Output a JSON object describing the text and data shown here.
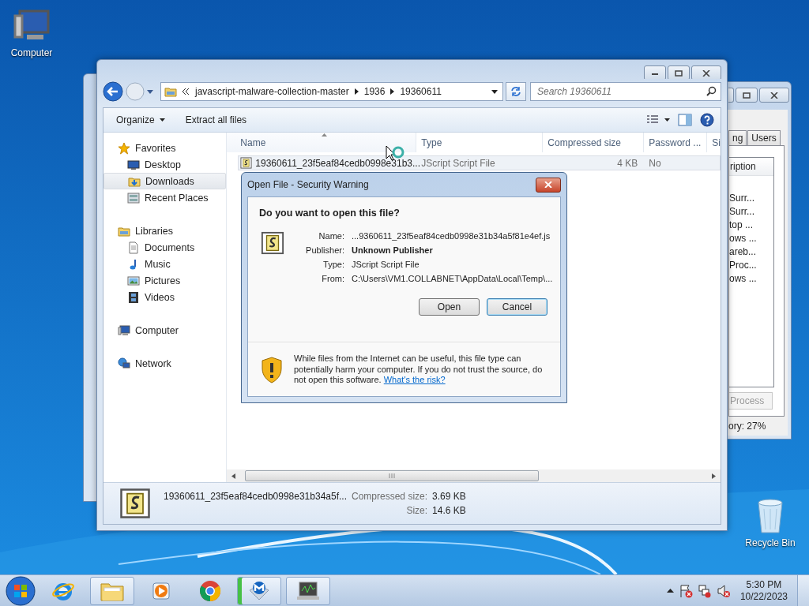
{
  "desktop": {
    "icons": [
      {
        "label": "Computer"
      },
      {
        "label": "Recycle Bin"
      }
    ]
  },
  "task_manager": {
    "tabs": [
      {
        "label": "ng",
        "selected": false
      },
      {
        "label": "Users",
        "selected": false
      }
    ],
    "column": "ription",
    "rows": [
      "Surr...",
      "Surr...",
      "top ...",
      "ows ...",
      "areb...",
      "Proc...",
      "ows ..."
    ],
    "end_button": {
      "label": "Process",
      "disabled": true
    },
    "status": "ory: 27%"
  },
  "explorer": {
    "breadcrumbs": [
      "javascript-malware-collection-master",
      "1936",
      "19360611"
    ],
    "search": {
      "placeholder": "Search 19360611"
    },
    "toolbar": [
      {
        "label": "Organize",
        "kind": "menu"
      },
      {
        "label": "Extract all files",
        "kind": "command"
      }
    ],
    "nav": [
      {
        "label": "Favorites",
        "selected": false,
        "children": [
          {
            "label": "Desktop",
            "selected": false
          },
          {
            "label": "Downloads",
            "selected": true
          },
          {
            "label": "Recent Places",
            "selected": false
          }
        ]
      },
      {
        "label": "Libraries",
        "selected": false,
        "children": [
          {
            "label": "Documents",
            "selected": false
          },
          {
            "label": "Music",
            "selected": false
          },
          {
            "label": "Pictures",
            "selected": false
          },
          {
            "label": "Videos",
            "selected": false
          }
        ]
      },
      {
        "label": "Computer",
        "selected": false
      },
      {
        "label": "Network",
        "selected": false
      }
    ],
    "columns": [
      {
        "label": "Name",
        "sorted": true
      },
      {
        "label": "Type",
        "sorted": false
      },
      {
        "label": "Compressed size",
        "sorted": false
      },
      {
        "label": "Password ...",
        "sorted": false
      },
      {
        "label": "Si",
        "sorted": false
      }
    ],
    "rows": [
      {
        "name": "19360611_23f5eaf84cedb0998e31b3...",
        "type": "JScript Script File",
        "compressed_size": "4 KB",
        "password": "No",
        "selected": true
      }
    ],
    "details": {
      "name": "19360611_23f5eaf84cedb0998e31b34a5f...",
      "fields": [
        {
          "label": "Compressed size:",
          "value": "3.69 KB"
        },
        {
          "label": "Size:",
          "value": "14.6 KB"
        }
      ]
    }
  },
  "dialog": {
    "title": "Open File - Security Warning",
    "question": "Do you want to open this file?",
    "fields": [
      {
        "label": "Name:",
        "value": "...9360611_23f5eaf84cedb0998e31b34a5f81e4ef.js",
        "kind": "plain"
      },
      {
        "label": "Publisher:",
        "value": "Unknown Publisher",
        "kind": "strong"
      },
      {
        "label": "Type:",
        "value": "JScript Script File",
        "kind": "plain"
      },
      {
        "label": "From:",
        "value": "C:\\Users\\VM1.COLLABNET\\AppData\\Local\\Temp\\...",
        "kind": "plain"
      }
    ],
    "buttons": [
      {
        "label": "Open",
        "default": false
      },
      {
        "label": "Cancel",
        "default": true
      }
    ],
    "warning": "While files from the Internet can be useful, this file type can potentially harm your computer. If you do not trust the source, do not open this software.",
    "risk_link": "What's the risk?"
  },
  "taskbar": {
    "items": [
      {
        "kind": "browser-e",
        "running": false
      },
      {
        "kind": "folders",
        "running": true
      },
      {
        "kind": "media",
        "running": false
      },
      {
        "kind": "chrome",
        "running": false
      },
      {
        "kind": "shield-m",
        "running": true
      },
      {
        "kind": "monitor",
        "running": true
      }
    ],
    "clock": {
      "time": "5:30 PM",
      "date": "10/22/2023"
    }
  }
}
